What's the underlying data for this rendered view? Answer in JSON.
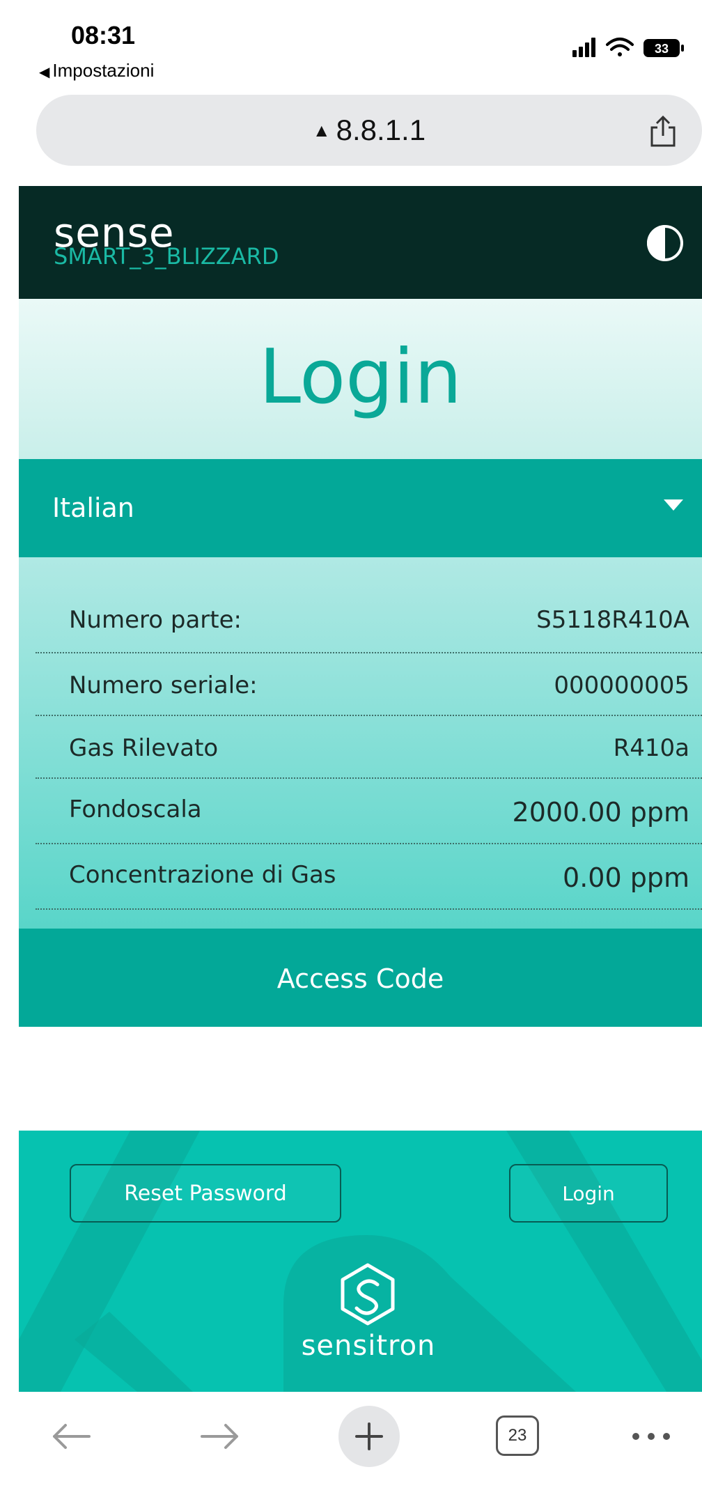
{
  "status_bar": {
    "time": "08:31",
    "back_app": "Impostazioni",
    "battery": "33"
  },
  "browser": {
    "url": "8.8.1.1",
    "tab_count": "23"
  },
  "app": {
    "brand": "sense",
    "device_name": "SMART_3_BLIZZARD",
    "page_title": "Login",
    "language": "Italian",
    "info_rows": [
      {
        "label": "Numero parte:",
        "value": "S5118R410A"
      },
      {
        "label": "Numero seriale:",
        "value": "000000005"
      },
      {
        "label": "Gas Rilevato",
        "value": "R410a"
      },
      {
        "label": "Fondoscala",
        "value": "2000.00 ppm"
      },
      {
        "label": "Concentrazione di Gas",
        "value": "0.00 ppm"
      }
    ],
    "access_code_label": "Access Code",
    "reset_password_label": "Reset Password",
    "login_button_label": "Login",
    "logo_text": "sensitron"
  },
  "colors": {
    "header_bg": "#062a25",
    "accent": "#03a898",
    "title_text": "#0aa897",
    "footer_bg": "#06c2b0"
  },
  "icons": [
    "signal-icon",
    "wifi-icon",
    "battery-icon",
    "share-icon",
    "contrast-icon",
    "chevron-down-icon",
    "sensitron-logo-icon",
    "back-arrow-icon",
    "forward-arrow-icon",
    "plus-icon",
    "tabs-icon",
    "more-icon"
  ]
}
